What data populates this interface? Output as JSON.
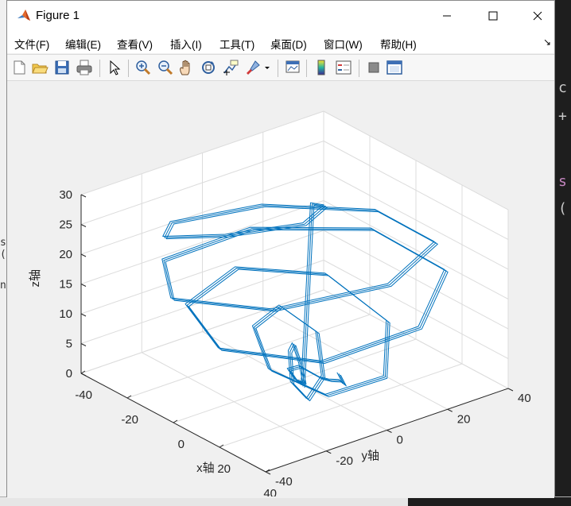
{
  "window": {
    "title": "Figure 1"
  },
  "menu": [
    "文件(F)",
    "编辑(E)",
    "查看(V)",
    "插入(I)",
    "工具(T)",
    "桌面(D)",
    "窗口(W)",
    "帮助(H)"
  ],
  "menu_overflow": "↘",
  "toolbar": [
    "new-figure",
    "open-file",
    "save",
    "print",
    "edit-plot-pointer",
    "zoom-in",
    "zoom-out",
    "pan-hand",
    "rotate-3d",
    "data-cursor",
    "brush",
    "link-plot",
    "colorbar",
    "legend",
    "hide-plot-tools",
    "show-plot-tools"
  ],
  "background": {
    "right_chars": [
      "c",
      "+",
      "s",
      "("
    ],
    "left_chars": [
      "s (",
      "n"
    ]
  },
  "chart_data": {
    "type": "line",
    "title": "",
    "xlabel": "x轴",
    "ylabel": "y轴",
    "zlabel": "z轴",
    "xticks": [
      -40,
      -20,
      0,
      20,
      40
    ],
    "yticks": [
      -40,
      -20,
      0,
      20,
      40
    ],
    "zticks": [
      0,
      5,
      10,
      15,
      20,
      25,
      30
    ],
    "xlim": [
      -40,
      40
    ],
    "ylim": [
      -40,
      40
    ],
    "zlim": [
      0,
      30
    ],
    "grid": true,
    "colors": {
      "line": "#0072bd",
      "grid": "#dcdcdc",
      "axes": "#262626",
      "panel": "#ffffff"
    },
    "series": [
      {
        "x": [
          3.2,
          1.5,
          4.2,
          8.1,
          -1.2,
          -12.6,
          -20.4,
          -15.5,
          3.6,
          25.8,
          34.3,
          22.5,
          -3.5,
          -26.2,
          -27.8,
          -8.5,
          21.0,
          39.7,
          35.5,
          8.7,
          -19.8,
          -30.6,
          -14.8,
          14.5,
          36.7,
          32.7,
          9.7,
          -14.1,
          -21.0,
          -5.5,
          13.6,
          20.3,
          9.6,
          -5.8,
          -10.4,
          -2.4,
          5.3,
          2.6,
          -3.6,
          -4.1,
          3.0,
          6.0,
          8.0,
          9.4,
          3.0
        ],
        "y": [
          -0.3,
          4.1,
          6.4,
          -3.5,
          -22.0,
          -33.9,
          -25.5,
          0.9,
          23.7,
          26.4,
          4.6,
          -24.9,
          -38.2,
          -23.8,
          6.5,
          31.5,
          33.4,
          10.6,
          -18.3,
          -31.8,
          -21.0,
          3.6,
          21.3,
          19.2,
          1.4,
          -14.8,
          -16.1,
          -3.2,
          10.8,
          11.1,
          -1.5,
          -11.6,
          -8.7,
          2.3,
          7.1,
          3.2,
          -1.4,
          -2.0,
          0.3,
          4.4,
          5.8,
          6.6,
          8.5,
          8.7,
          11.7
        ],
        "z": [
          0.0,
          29.5,
          29.3,
          28.8,
          28.2,
          27.6,
          27.0,
          26.3,
          25.4,
          24.1,
          22.6,
          21.1,
          19.9,
          19.2,
          18.9,
          18.4,
          17.2,
          15.5,
          13.9,
          12.9,
          12.5,
          12.2,
          11.3,
          9.8,
          8.2,
          7.1,
          6.9,
          6.9,
          6.5,
          5.3,
          4.0,
          3.3,
          3.4,
          3.5,
          3.0,
          1.9,
          1.2,
          1.2,
          1.3,
          1.0,
          0.3,
          0.4,
          0.4,
          0.0,
          0.0
        ]
      }
    ]
  }
}
